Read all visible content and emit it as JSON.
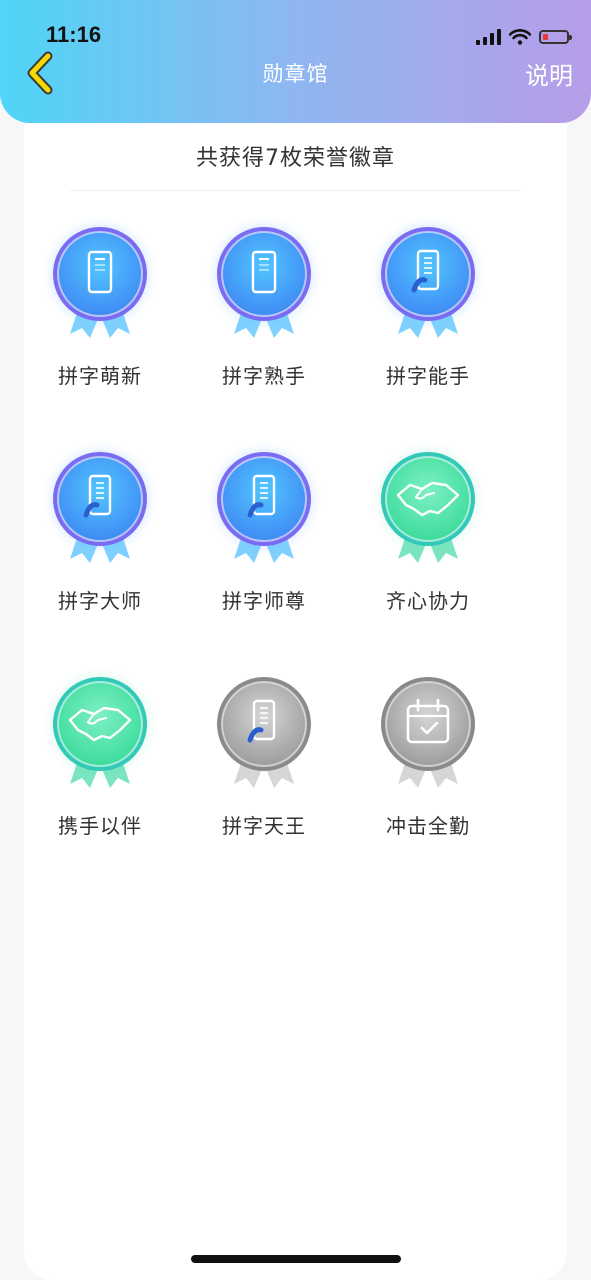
{
  "status_bar": {
    "time": "11:16"
  },
  "header": {
    "title": "勋章馆",
    "explain_label": "说明"
  },
  "summary": {
    "text": "共获得7枚荣誉徽章"
  },
  "badges": [
    {
      "name": "拼字萌新",
      "icon": "phone-icon",
      "state": "earned",
      "color": "blue"
    },
    {
      "name": "拼字熟手",
      "icon": "phone-icon",
      "state": "earned",
      "color": "blue"
    },
    {
      "name": "拼字能手",
      "icon": "phone-pen-icon",
      "state": "earned",
      "color": "blue"
    },
    {
      "name": "拼字大师",
      "icon": "phone-pen-icon",
      "state": "earned",
      "color": "blue"
    },
    {
      "name": "拼字师尊",
      "icon": "phone-pen-icon",
      "state": "earned",
      "color": "blue"
    },
    {
      "name": "齐心协力",
      "icon": "handshake-icon",
      "state": "earned",
      "color": "green"
    },
    {
      "name": "携手以伴",
      "icon": "handshake-icon",
      "state": "earned",
      "color": "green"
    },
    {
      "name": "拼字天王",
      "icon": "phone-pen-icon",
      "state": "locked",
      "color": "gray"
    },
    {
      "name": "冲击全勤",
      "icon": "calendar-check-icon",
      "state": "locked",
      "color": "gray"
    }
  ],
  "colors": {
    "header_gradient": [
      "#4fd5f7",
      "#8fb6f0",
      "#b79de8"
    ],
    "back_arrow": "#f5d900",
    "blue_badge": "#3f8bf4",
    "green_badge": "#3ddc9c",
    "gray_badge": "#9a9a9a",
    "battery_low": "#e53935"
  }
}
